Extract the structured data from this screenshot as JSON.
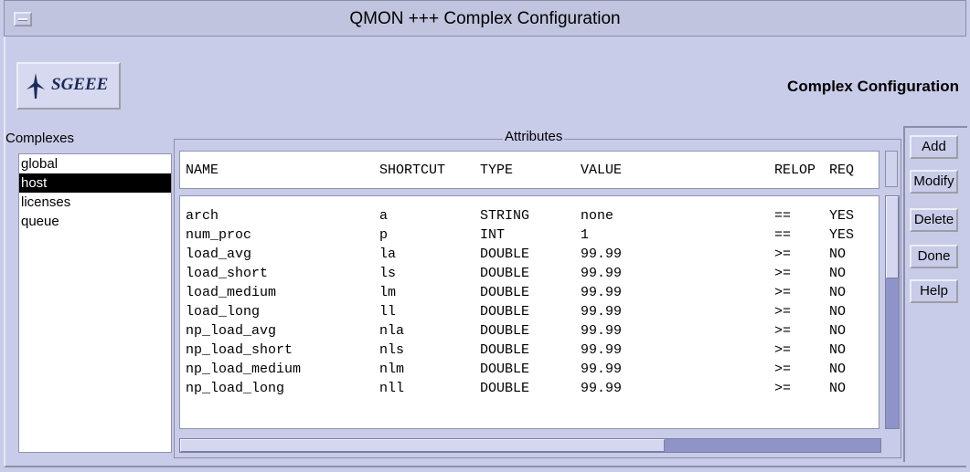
{
  "window": {
    "title": "QMON +++ Complex Configuration"
  },
  "header": {
    "logo_text": "SGEEE",
    "title": "Complex Configuration"
  },
  "complexes": {
    "label": "Complexes",
    "items": [
      "global",
      "host",
      "licenses",
      "queue"
    ],
    "selected": "host"
  },
  "attributes": {
    "label": "Attributes",
    "columns": [
      "NAME",
      "SHORTCUT",
      "TYPE",
      "VALUE",
      "RELOP",
      "REQ"
    ],
    "rows": [
      [
        "arch",
        "a",
        "STRING",
        "none",
        "==",
        "YES"
      ],
      [
        "num_proc",
        "p",
        "INT",
        "1",
        "==",
        "YES"
      ],
      [
        "load_avg",
        "la",
        "DOUBLE",
        "99.99",
        ">=",
        "NO"
      ],
      [
        "load_short",
        "ls",
        "DOUBLE",
        "99.99",
        ">=",
        "NO"
      ],
      [
        "load_medium",
        "lm",
        "DOUBLE",
        "99.99",
        ">=",
        "NO"
      ],
      [
        "load_long",
        "ll",
        "DOUBLE",
        "99.99",
        ">=",
        "NO"
      ],
      [
        "np_load_avg",
        "nla",
        "DOUBLE",
        "99.99",
        ">=",
        "NO"
      ],
      [
        "np_load_short",
        "nls",
        "DOUBLE",
        "99.99",
        ">=",
        "NO"
      ],
      [
        "np_load_medium",
        "nlm",
        "DOUBLE",
        "99.99",
        ">=",
        "NO"
      ],
      [
        "np_load_long",
        "nll",
        "DOUBLE",
        "99.99",
        ">=",
        "NO"
      ]
    ]
  },
  "buttons": {
    "add": "Add",
    "modify": "Modify",
    "delete": "Delete",
    "done": "Done",
    "help": "Help"
  },
  "colors": {
    "window_bg": "#c8cce8",
    "selection_bg": "#000000",
    "scroll_trough": "#8e94c8"
  }
}
